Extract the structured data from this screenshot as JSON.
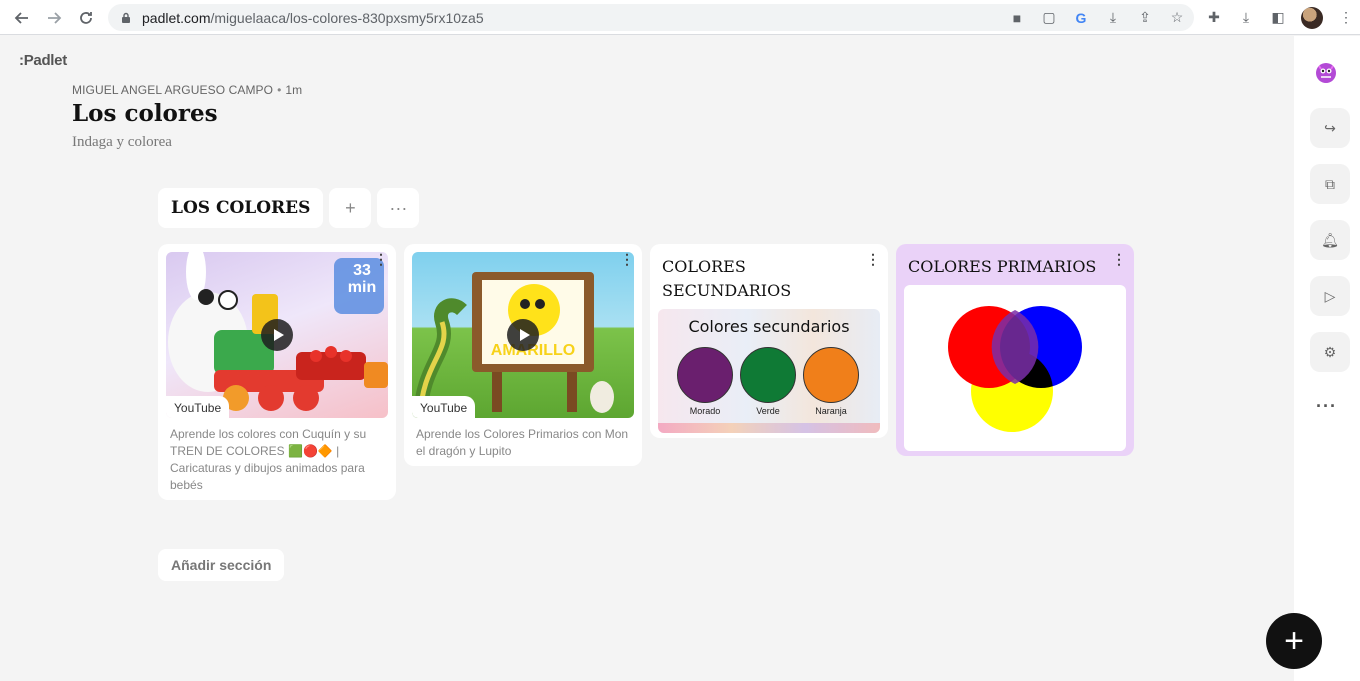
{
  "browser": {
    "url_domain": "padlet.com",
    "url_path": "/miguelaaca/los-colores-830pxsmy5rx10za5",
    "nav_icons": [
      "back-arrow-icon",
      "forward-arrow-icon",
      "reload-icon"
    ],
    "omnibox_icons": [
      "camera-icon",
      "clipboard-icon",
      "google-icon",
      "download-box-icon",
      "share-icon",
      "star-icon"
    ],
    "toolbar_icons": [
      "puzzle-icon",
      "download-icon",
      "sidepanel-icon",
      "avatar",
      "kebab-icon"
    ]
  },
  "padlet": {
    "brand": ":Padlet",
    "author": "MIGUEL ANGEL ARGUESO CAMPO",
    "age": "1m",
    "title": "Los colores",
    "subtitle": "Indaga y colorea"
  },
  "section": {
    "title": "LOS COLORES",
    "add_icon": "+",
    "more_icon": "···"
  },
  "cards": [
    {
      "source": "YouTube",
      "description": "Aprende los colores con Cuquín y su TREN DE COLORES 🟩🔴🔶 | Caricaturas y dibujos animados para bebés",
      "thumb_badge": "33 min"
    },
    {
      "source": "YouTube",
      "description": "Aprende los Colores Primarios con Mon el dragón y Lupito",
      "thumb_badge": "AMARILLO"
    },
    {
      "title": "COLORES SECUNDARIOS",
      "image_heading": "Colores secundarios",
      "swatches": [
        {
          "label": "Morado",
          "color": "#6a1f6e"
        },
        {
          "label": "Verde",
          "color": "#0f7a35"
        },
        {
          "label": "Naranja",
          "color": "#f07f1a"
        }
      ]
    },
    {
      "title": "COLORES PRIMARIOS",
      "colors": [
        "#ff0000",
        "#0000ff",
        "#ffff00"
      ]
    }
  ],
  "add_section": "Añadir sección",
  "rail_icons": [
    "profile-monster-icon",
    "share-arrow-icon",
    "remake-icon",
    "bell-icon",
    "play-icon",
    "settings-icon",
    "more-dots-icon"
  ],
  "fab_label": "+"
}
